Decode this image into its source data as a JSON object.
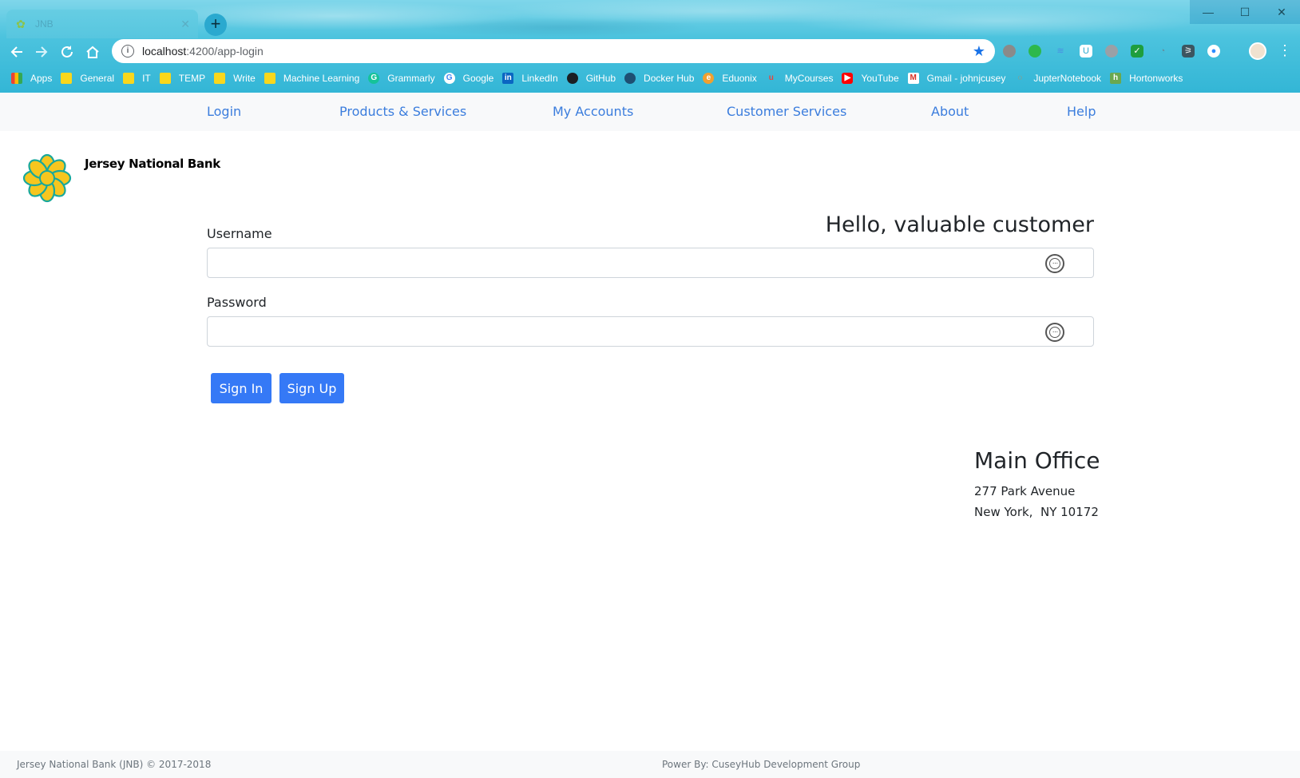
{
  "browser": {
    "tab_title": "JNB",
    "url_host": "localhost",
    "url_rest": ":4200/app-login",
    "bookmarks": [
      {
        "label": "Apps",
        "icon": "apps-grid-icon"
      },
      {
        "label": "General",
        "icon": "folder-icon"
      },
      {
        "label": "IT",
        "icon": "folder-icon"
      },
      {
        "label": "TEMP",
        "icon": "folder-icon"
      },
      {
        "label": "Write",
        "icon": "folder-icon"
      },
      {
        "label": "Machine Learning",
        "icon": "folder-icon"
      },
      {
        "label": "Grammarly",
        "icon": "grammarly-icon"
      },
      {
        "label": "Google",
        "icon": "google-icon"
      },
      {
        "label": "LinkedIn",
        "icon": "linkedin-icon"
      },
      {
        "label": "GitHub",
        "icon": "github-icon"
      },
      {
        "label": "Docker Hub",
        "icon": "docker-icon"
      },
      {
        "label": "Eduonix",
        "icon": "eduonix-icon"
      },
      {
        "label": "MyCourses",
        "icon": "mycourses-icon"
      },
      {
        "label": "YouTube",
        "icon": "youtube-icon"
      },
      {
        "label": "Gmail - johnjcusey",
        "icon": "gmail-icon"
      },
      {
        "label": "JupterNotebook",
        "icon": "jupyter-icon"
      },
      {
        "label": "Hortonworks",
        "icon": "hortonworks-icon"
      }
    ]
  },
  "nav": {
    "login": "Login",
    "products": "Products & Services",
    "accounts": "My Accounts",
    "customer_services": "Customer Services",
    "about": "About",
    "help": "Help"
  },
  "brand": {
    "name": "Jersey National Bank"
  },
  "login": {
    "greeting": "Hello, valuable customer",
    "username_label": "Username",
    "password_label": "Password",
    "username_value": "",
    "password_value": "",
    "sign_in": "Sign In",
    "sign_up": "Sign Up"
  },
  "office": {
    "title": "Main Office",
    "line1": "277 Park Avenue",
    "line2": "New York,  NY 10172"
  },
  "footer": {
    "copyright": "Jersey National Bank (JNB) © 2017-2018",
    "powered": "Power By: CuseyHub Development Group"
  },
  "colors": {
    "link": "#3b7ddd",
    "button": "#3579f6",
    "nav_bg": "#f8f9fa"
  }
}
